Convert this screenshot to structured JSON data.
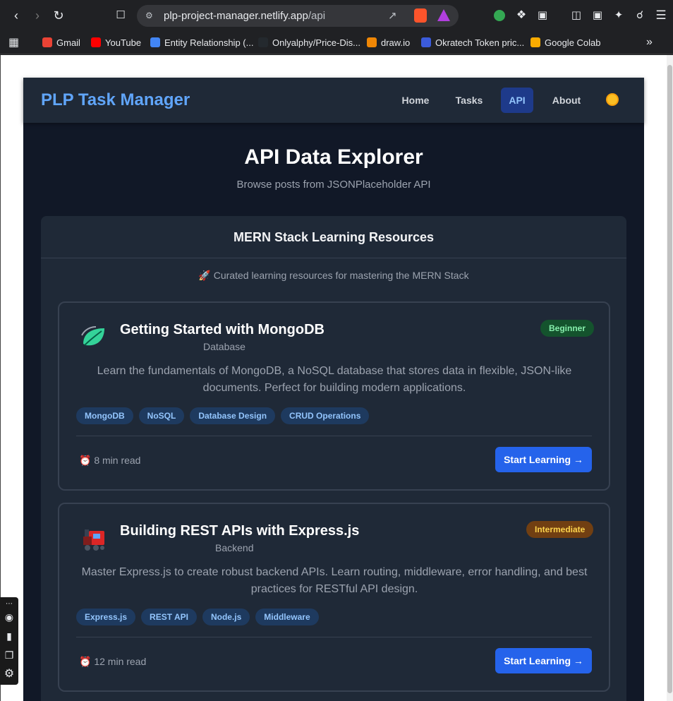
{
  "browser": {
    "url_domain": "plp-project-manager.netlify.app",
    "url_path": "/api",
    "bookmarks": [
      {
        "label": "Gmail",
        "color": "#ea4335"
      },
      {
        "label": "YouTube",
        "color": "#ff0000"
      },
      {
        "label": "Entity Relationship (...",
        "color": "#4285f4"
      },
      {
        "label": "Onlyalphy/Price-Dis...",
        "color": "#24292e"
      },
      {
        "label": "draw.io",
        "color": "#f08705"
      },
      {
        "label": "Okratech Token pric...",
        "color": "#3b5bdb"
      },
      {
        "label": "Google Colab",
        "color": "#f9ab00"
      }
    ],
    "more_bookmarks": "»"
  },
  "app": {
    "brand": "PLP Task Manager",
    "nav": [
      {
        "label": "Home"
      },
      {
        "label": "Tasks"
      },
      {
        "label": "API",
        "active": true
      },
      {
        "label": "About"
      }
    ],
    "theme_icon": "sun-icon"
  },
  "page": {
    "title": "API Data Explorer",
    "subtitle": "Browse posts from JSONPlaceholder API"
  },
  "panel": {
    "heading": "MERN Stack Learning Resources",
    "note": "🚀 Curated learning resources for mastering the MERN Stack",
    "cards": [
      {
        "icon": "leaf-icon",
        "title": "Getting Started with MongoDB",
        "category": "Database",
        "level": "Beginner",
        "level_bg": "#14532d",
        "level_fg": "#86efac",
        "description": "Learn the fundamentals of MongoDB, a NoSQL database that stores data in flexible, JSON-like documents. Perfect for building modern applications.",
        "tags": [
          "MongoDB",
          "NoSQL",
          "Database Design",
          "CRUD Operations"
        ],
        "read_time": "8 min read",
        "button": "Start Learning →"
      },
      {
        "icon": "train-icon",
        "title": "Building REST APIs with Express.js",
        "category": "Backend",
        "level": "Intermediate",
        "level_bg": "#713f12",
        "level_fg": "#fcd34d",
        "description": "Master Express.js to create robust backend APIs. Learn routing, middleware, error handling, and best practices for RESTful API design.",
        "tags": [
          "Express.js",
          "REST API",
          "Node.js",
          "Middleware"
        ],
        "read_time": "12 min read",
        "button": "Start Learning →"
      }
    ]
  }
}
